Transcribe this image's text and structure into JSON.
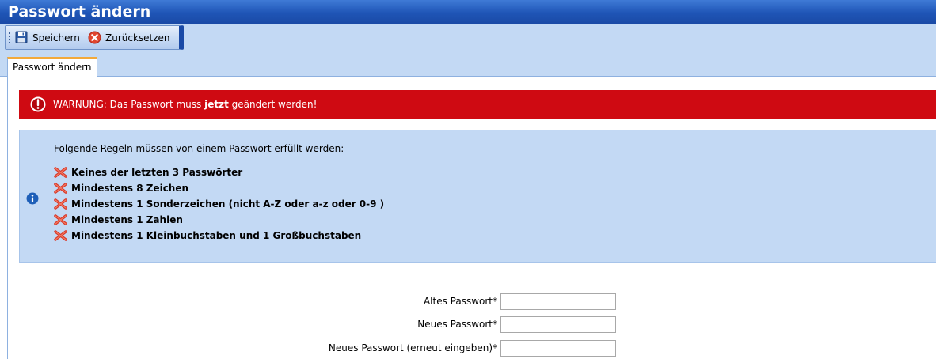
{
  "window": {
    "title": "Passwort ändern"
  },
  "toolbar": {
    "save_label": "Speichern",
    "reset_label": "Zurücksetzen",
    "save_icon": "floppy-disk-icon",
    "reset_icon": "red-x-circle-icon"
  },
  "tabs": [
    {
      "label": "Passwort ändern",
      "active": true
    }
  ],
  "warning": {
    "prefix": "WARNUNG: Das Passwort muss ",
    "emphasis": "jetzt",
    "suffix": " geändert werden!",
    "icon": "warning-circle-icon",
    "color": "#cf0a12"
  },
  "info": {
    "intro": "Folgende Regeln müssen von einem Passwort erfüllt werden:",
    "icon": "info-icon",
    "rules": [
      {
        "text": "Keines der letzten 3 Passwörter",
        "status": "failed"
      },
      {
        "text": "Mindestens 8 Zeichen",
        "status": "failed"
      },
      {
        "text": "Mindestens 1 Sonderzeichen (nicht A-Z oder a-z oder 0-9 )",
        "status": "failed"
      },
      {
        "text": "Mindestens 1 Zahlen",
        "status": "failed"
      },
      {
        "text": "Mindestens 1 Kleinbuchstaben und 1 Großbuchstaben",
        "status": "failed"
      }
    ]
  },
  "form": {
    "old_password": {
      "label": "Altes Passwort*",
      "value": ""
    },
    "new_password": {
      "label": "Neues Passwort*",
      "value": ""
    },
    "confirm_password": {
      "label": "Neues Passwort (erneut eingeben)*",
      "value": ""
    }
  },
  "colors": {
    "title_bar": "#1f55b6",
    "panel": "#c3d9f4",
    "tab_accent": "#f2a93b"
  }
}
